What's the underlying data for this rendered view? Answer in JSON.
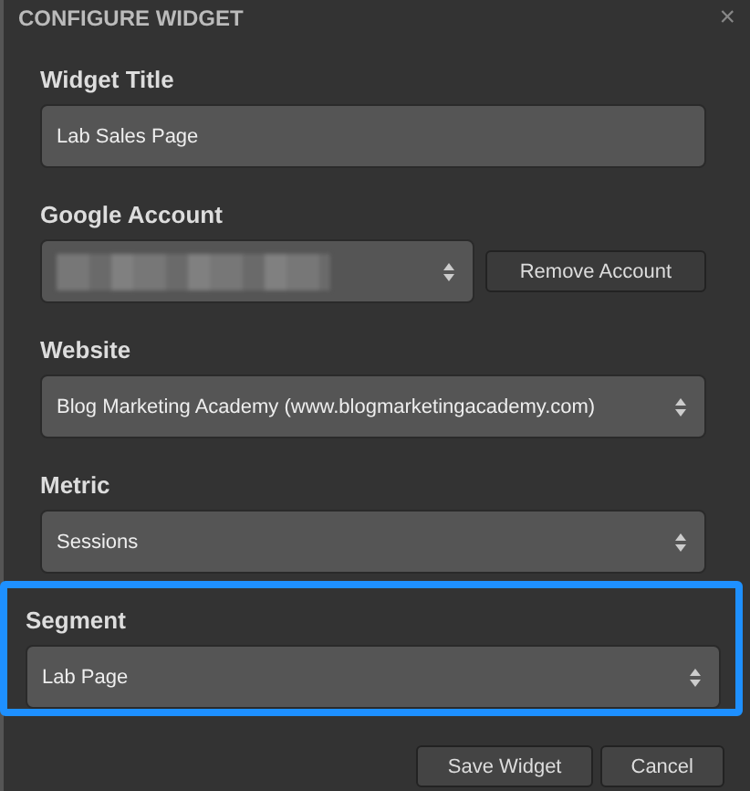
{
  "dialog": {
    "title": "CONFIGURE WIDGET",
    "close": "×"
  },
  "fields": [
    {
      "kind": "text",
      "label": "Widget Title",
      "value": "Lab Sales Page",
      "highlighted": false
    },
    {
      "kind": "select",
      "label": "Google Account",
      "redacted": true,
      "action": "Remove Account",
      "highlighted": false
    },
    {
      "kind": "select",
      "label": "Website",
      "value": "Blog Marketing Academy (www.blogmarketingacademy.com)",
      "highlighted": false
    },
    {
      "kind": "select",
      "label": "Metric",
      "value": "Sessions",
      "highlighted": false
    },
    {
      "kind": "select",
      "label": "Segment",
      "value": "Lab Page",
      "highlighted": true
    }
  ],
  "buttons": [
    "Save Widget",
    "Cancel"
  ]
}
